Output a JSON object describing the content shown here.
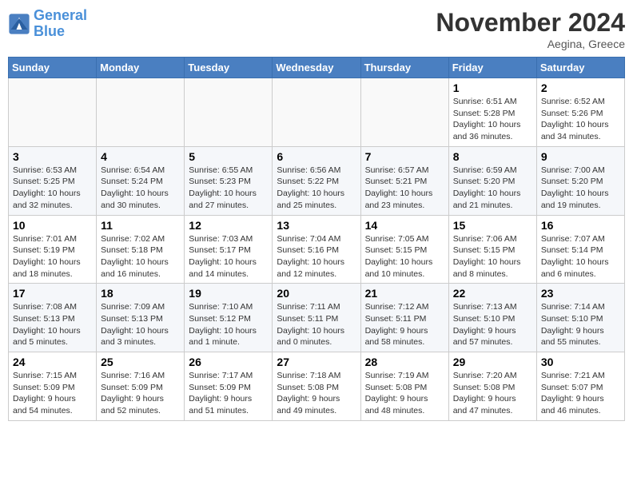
{
  "logo": {
    "line1": "General",
    "line2": "Blue"
  },
  "title": "November 2024",
  "location": "Aegina, Greece",
  "weekdays": [
    "Sunday",
    "Monday",
    "Tuesday",
    "Wednesday",
    "Thursday",
    "Friday",
    "Saturday"
  ],
  "weeks": [
    [
      {
        "day": "",
        "info": ""
      },
      {
        "day": "",
        "info": ""
      },
      {
        "day": "",
        "info": ""
      },
      {
        "day": "",
        "info": ""
      },
      {
        "day": "",
        "info": ""
      },
      {
        "day": "1",
        "info": "Sunrise: 6:51 AM\nSunset: 5:28 PM\nDaylight: 10 hours\nand 36 minutes."
      },
      {
        "day": "2",
        "info": "Sunrise: 6:52 AM\nSunset: 5:26 PM\nDaylight: 10 hours\nand 34 minutes."
      }
    ],
    [
      {
        "day": "3",
        "info": "Sunrise: 6:53 AM\nSunset: 5:25 PM\nDaylight: 10 hours\nand 32 minutes."
      },
      {
        "day": "4",
        "info": "Sunrise: 6:54 AM\nSunset: 5:24 PM\nDaylight: 10 hours\nand 30 minutes."
      },
      {
        "day": "5",
        "info": "Sunrise: 6:55 AM\nSunset: 5:23 PM\nDaylight: 10 hours\nand 27 minutes."
      },
      {
        "day": "6",
        "info": "Sunrise: 6:56 AM\nSunset: 5:22 PM\nDaylight: 10 hours\nand 25 minutes."
      },
      {
        "day": "7",
        "info": "Sunrise: 6:57 AM\nSunset: 5:21 PM\nDaylight: 10 hours\nand 23 minutes."
      },
      {
        "day": "8",
        "info": "Sunrise: 6:59 AM\nSunset: 5:20 PM\nDaylight: 10 hours\nand 21 minutes."
      },
      {
        "day": "9",
        "info": "Sunrise: 7:00 AM\nSunset: 5:20 PM\nDaylight: 10 hours\nand 19 minutes."
      }
    ],
    [
      {
        "day": "10",
        "info": "Sunrise: 7:01 AM\nSunset: 5:19 PM\nDaylight: 10 hours\nand 18 minutes."
      },
      {
        "day": "11",
        "info": "Sunrise: 7:02 AM\nSunset: 5:18 PM\nDaylight: 10 hours\nand 16 minutes."
      },
      {
        "day": "12",
        "info": "Sunrise: 7:03 AM\nSunset: 5:17 PM\nDaylight: 10 hours\nand 14 minutes."
      },
      {
        "day": "13",
        "info": "Sunrise: 7:04 AM\nSunset: 5:16 PM\nDaylight: 10 hours\nand 12 minutes."
      },
      {
        "day": "14",
        "info": "Sunrise: 7:05 AM\nSunset: 5:15 PM\nDaylight: 10 hours\nand 10 minutes."
      },
      {
        "day": "15",
        "info": "Sunrise: 7:06 AM\nSunset: 5:15 PM\nDaylight: 10 hours\nand 8 minutes."
      },
      {
        "day": "16",
        "info": "Sunrise: 7:07 AM\nSunset: 5:14 PM\nDaylight: 10 hours\nand 6 minutes."
      }
    ],
    [
      {
        "day": "17",
        "info": "Sunrise: 7:08 AM\nSunset: 5:13 PM\nDaylight: 10 hours\nand 5 minutes."
      },
      {
        "day": "18",
        "info": "Sunrise: 7:09 AM\nSunset: 5:13 PM\nDaylight: 10 hours\nand 3 minutes."
      },
      {
        "day": "19",
        "info": "Sunrise: 7:10 AM\nSunset: 5:12 PM\nDaylight: 10 hours\nand 1 minute."
      },
      {
        "day": "20",
        "info": "Sunrise: 7:11 AM\nSunset: 5:11 PM\nDaylight: 10 hours\nand 0 minutes."
      },
      {
        "day": "21",
        "info": "Sunrise: 7:12 AM\nSunset: 5:11 PM\nDaylight: 9 hours\nand 58 minutes."
      },
      {
        "day": "22",
        "info": "Sunrise: 7:13 AM\nSunset: 5:10 PM\nDaylight: 9 hours\nand 57 minutes."
      },
      {
        "day": "23",
        "info": "Sunrise: 7:14 AM\nSunset: 5:10 PM\nDaylight: 9 hours\nand 55 minutes."
      }
    ],
    [
      {
        "day": "24",
        "info": "Sunrise: 7:15 AM\nSunset: 5:09 PM\nDaylight: 9 hours\nand 54 minutes."
      },
      {
        "day": "25",
        "info": "Sunrise: 7:16 AM\nSunset: 5:09 PM\nDaylight: 9 hours\nand 52 minutes."
      },
      {
        "day": "26",
        "info": "Sunrise: 7:17 AM\nSunset: 5:09 PM\nDaylight: 9 hours\nand 51 minutes."
      },
      {
        "day": "27",
        "info": "Sunrise: 7:18 AM\nSunset: 5:08 PM\nDaylight: 9 hours\nand 49 minutes."
      },
      {
        "day": "28",
        "info": "Sunrise: 7:19 AM\nSunset: 5:08 PM\nDaylight: 9 hours\nand 48 minutes."
      },
      {
        "day": "29",
        "info": "Sunrise: 7:20 AM\nSunset: 5:08 PM\nDaylight: 9 hours\nand 47 minutes."
      },
      {
        "day": "30",
        "info": "Sunrise: 7:21 AM\nSunset: 5:07 PM\nDaylight: 9 hours\nand 46 minutes."
      }
    ]
  ]
}
